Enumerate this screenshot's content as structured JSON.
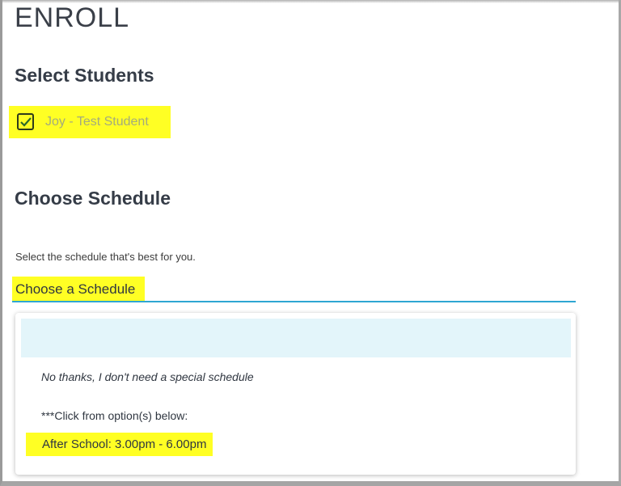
{
  "page": {
    "title": "ENROLL"
  },
  "students": {
    "heading": "Select Students",
    "items": [
      {
        "label": "Joy - Test Student",
        "checked": true
      }
    ]
  },
  "schedule": {
    "heading": "Choose Schedule",
    "help_text": "Select the schedule that's best for you.",
    "selected_value": "Choose a Schedule",
    "options": [
      {
        "label": ""
      },
      {
        "label": "No thanks, I don't need a special schedule"
      },
      {
        "label": "***Click from option(s) below:"
      },
      {
        "label": "After School: 3.00pm - 6.00pm"
      }
    ]
  },
  "colors": {
    "highlight": "#ffff24",
    "accent_underline": "#2ea6d2",
    "option_hover": "#e3f5fa"
  }
}
